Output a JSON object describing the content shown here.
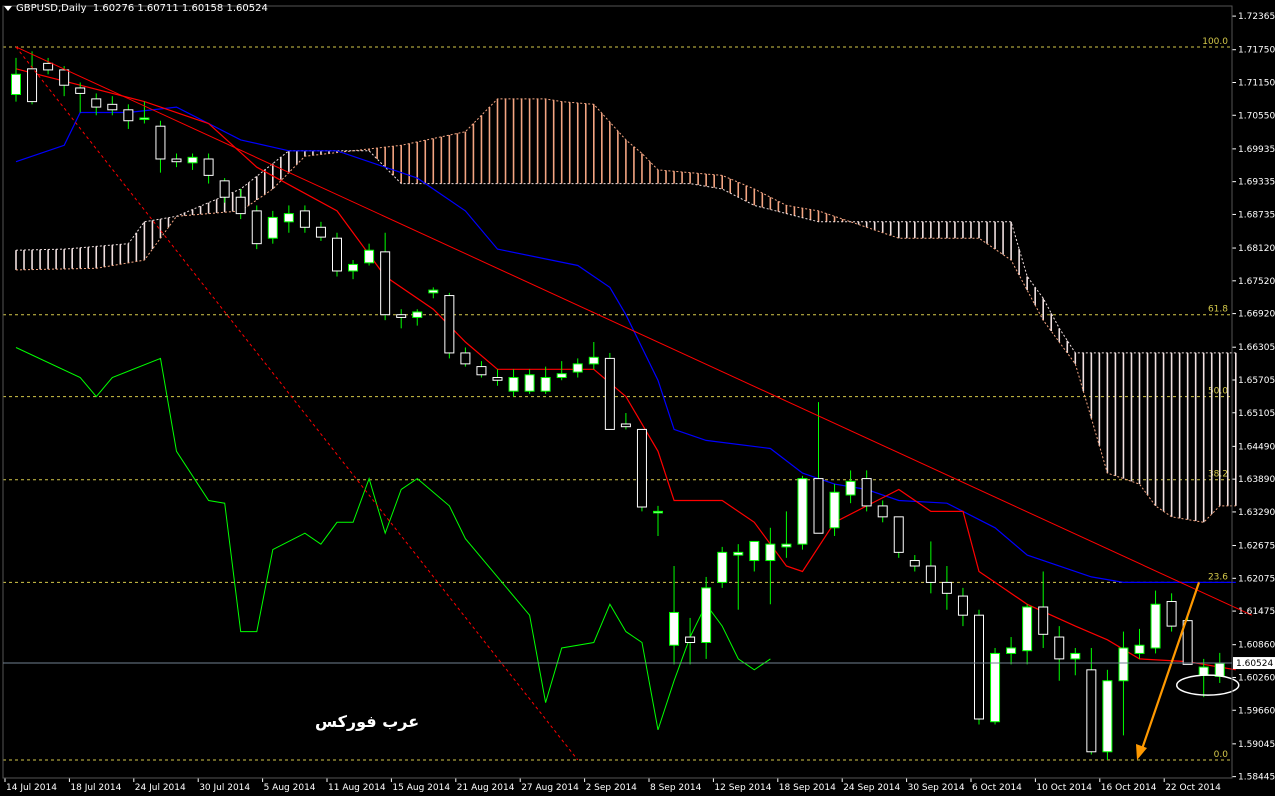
{
  "header": {
    "symbol": "GBPUSD,Daily",
    "ohlc": "1.60276 1.60711 1.60158 1.60524"
  },
  "watermark": "عرب فوركس",
  "current_price_label": "1.60524",
  "colors": {
    "background": "#000000",
    "bull_candle": "#ffffff",
    "bear_candle": "#000000",
    "wick": "#00ff00",
    "tenkan": "#ff0000",
    "kijun": "#0000ff",
    "chikou": "#00ff00",
    "cloud_bull": "#f4a582",
    "cloud_bear": "#f0e0e0",
    "trendline": "#ff0000",
    "fib": "#d4c84a",
    "arrow": "#ff9900",
    "current_price_line": "#708090"
  },
  "chart_data": {
    "type": "candlestick",
    "y_ticks": [
      "1.72365",
      "1.71750",
      "1.71150",
      "1.70550",
      "1.69935",
      "1.69335",
      "1.68735",
      "1.68120",
      "1.67520",
      "1.66920",
      "1.66305",
      "1.65705",
      "1.65105",
      "1.64490",
      "1.63890",
      "1.63290",
      "1.62675",
      "1.62075",
      "1.61475",
      "1.60860",
      "1.60260",
      "1.59660",
      "1.59045",
      "1.58445"
    ],
    "ylim": [
      1.5842,
      1.7255
    ],
    "x_ticks": [
      "14 Jul 2014",
      "18 Jul 2014",
      "24 Jul 2014",
      "30 Jul 2014",
      "5 Aug 2014",
      "11 Aug 2014",
      "15 Aug 2014",
      "21 Aug 2014",
      "27 Aug 2014",
      "2 Sep 2014",
      "8 Sep 2014",
      "12 Sep 2014",
      "18 Sep 2014",
      "24 Sep 2014",
      "30 Sep 2014",
      "6 Oct 2014",
      "10 Oct 2014",
      "16 Oct 2014",
      "22 Oct 2014"
    ],
    "fib_levels": [
      {
        "label": "100.0",
        "value": 1.718
      },
      {
        "label": "61.8",
        "value": 1.669
      },
      {
        "label": "50.0",
        "value": 1.654
      },
      {
        "label": "38.2",
        "value": 1.6388
      },
      {
        "label": "23.6",
        "value": 1.62
      },
      {
        "label": "0.0",
        "value": 1.5875
      }
    ],
    "current_price": 1.60524,
    "candles": [
      {
        "o": 1.7093,
        "h": 1.716,
        "l": 1.708,
        "c": 1.713
      },
      {
        "o": 1.714,
        "h": 1.7172,
        "l": 1.7075,
        "c": 1.708
      },
      {
        "o": 1.715,
        "h": 1.716,
        "l": 1.713,
        "c": 1.7138
      },
      {
        "o": 1.7138,
        "h": 1.7145,
        "l": 1.709,
        "c": 1.711
      },
      {
        "o": 1.7105,
        "h": 1.7115,
        "l": 1.706,
        "c": 1.7095
      },
      {
        "o": 1.7085,
        "h": 1.7095,
        "l": 1.7055,
        "c": 1.707
      },
      {
        "o": 1.7075,
        "h": 1.709,
        "l": 1.7055,
        "c": 1.7065
      },
      {
        "o": 1.7065,
        "h": 1.7075,
        "l": 1.703,
        "c": 1.7045
      },
      {
        "o": 1.705,
        "h": 1.708,
        "l": 1.704,
        "c": 1.705
      },
      {
        "o": 1.7035,
        "h": 1.7045,
        "l": 1.695,
        "c": 1.6975
      },
      {
        "o": 1.6975,
        "h": 1.6985,
        "l": 1.696,
        "c": 1.697
      },
      {
        "o": 1.6968,
        "h": 1.6985,
        "l": 1.6955,
        "c": 1.6978
      },
      {
        "o": 1.6975,
        "h": 1.6985,
        "l": 1.693,
        "c": 1.6945
      },
      {
        "o": 1.6935,
        "h": 1.694,
        "l": 1.6895,
        "c": 1.6905
      },
      {
        "o": 1.6905,
        "h": 1.692,
        "l": 1.6865,
        "c": 1.6875
      },
      {
        "o": 1.688,
        "h": 1.689,
        "l": 1.681,
        "c": 1.682
      },
      {
        "o": 1.683,
        "h": 1.688,
        "l": 1.682,
        "c": 1.6868
      },
      {
        "o": 1.686,
        "h": 1.689,
        "l": 1.684,
        "c": 1.6875
      },
      {
        "o": 1.688,
        "h": 1.689,
        "l": 1.684,
        "c": 1.685
      },
      {
        "o": 1.685,
        "h": 1.686,
        "l": 1.6825,
        "c": 1.6832
      },
      {
        "o": 1.683,
        "h": 1.684,
        "l": 1.676,
        "c": 1.677
      },
      {
        "o": 1.677,
        "h": 1.679,
        "l": 1.6755,
        "c": 1.6782
      },
      {
        "o": 1.6785,
        "h": 1.682,
        "l": 1.678,
        "c": 1.6808
      },
      {
        "o": 1.6805,
        "h": 1.684,
        "l": 1.668,
        "c": 1.669
      },
      {
        "o": 1.669,
        "h": 1.67,
        "l": 1.6665,
        "c": 1.6685
      },
      {
        "o": 1.6685,
        "h": 1.67,
        "l": 1.667,
        "c": 1.6695
      },
      {
        "o": 1.673,
        "h": 1.674,
        "l": 1.672,
        "c": 1.6735
      },
      {
        "o": 1.6725,
        "h": 1.673,
        "l": 1.661,
        "c": 1.662
      },
      {
        "o": 1.662,
        "h": 1.663,
        "l": 1.6595,
        "c": 1.66
      },
      {
        "o": 1.6595,
        "h": 1.6605,
        "l": 1.6575,
        "c": 1.658
      },
      {
        "o": 1.6575,
        "h": 1.659,
        "l": 1.656,
        "c": 1.657
      },
      {
        "o": 1.655,
        "h": 1.659,
        "l": 1.654,
        "c": 1.6575
      },
      {
        "o": 1.655,
        "h": 1.659,
        "l": 1.6545,
        "c": 1.658
      },
      {
        "o": 1.655,
        "h": 1.6595,
        "l": 1.6545,
        "c": 1.6575
      },
      {
        "o": 1.6575,
        "h": 1.6605,
        "l": 1.657,
        "c": 1.6582
      },
      {
        "o": 1.6585,
        "h": 1.661,
        "l": 1.6575,
        "c": 1.66
      },
      {
        "o": 1.66,
        "h": 1.664,
        "l": 1.659,
        "c": 1.6612
      },
      {
        "o": 1.661,
        "h": 1.662,
        "l": 1.648,
        "c": 1.648
      },
      {
        "o": 1.649,
        "h": 1.651,
        "l": 1.648,
        "c": 1.6485
      },
      {
        "o": 1.648,
        "h": 1.648,
        "l": 1.633,
        "c": 1.6338
      },
      {
        "o": 1.633,
        "h": 1.634,
        "l": 1.6285,
        "c": 1.633
      },
      {
        "o": 1.6085,
        "h": 1.623,
        "l": 1.605,
        "c": 1.6145
      },
      {
        "o": 1.61,
        "h": 1.6135,
        "l": 1.605,
        "c": 1.609
      },
      {
        "o": 1.609,
        "h": 1.621,
        "l": 1.606,
        "c": 1.619
      },
      {
        "o": 1.62,
        "h": 1.6265,
        "l": 1.619,
        "c": 1.6255
      },
      {
        "o": 1.625,
        "h": 1.627,
        "l": 1.615,
        "c": 1.6255
      },
      {
        "o": 1.624,
        "h": 1.6275,
        "l": 1.622,
        "c": 1.6275
      },
      {
        "o": 1.624,
        "h": 1.63,
        "l": 1.616,
        "c": 1.627
      },
      {
        "o": 1.6265,
        "h": 1.633,
        "l": 1.6245,
        "c": 1.627
      },
      {
        "o": 1.627,
        "h": 1.6395,
        "l": 1.626,
        "c": 1.639
      },
      {
        "o": 1.639,
        "h": 1.653,
        "l": 1.629,
        "c": 1.629
      },
      {
        "o": 1.63,
        "h": 1.638,
        "l": 1.6285,
        "c": 1.6365
      },
      {
        "o": 1.636,
        "h": 1.6405,
        "l": 1.6345,
        "c": 1.6385
      },
      {
        "o": 1.639,
        "h": 1.6405,
        "l": 1.633,
        "c": 1.634
      },
      {
        "o": 1.634,
        "h": 1.635,
        "l": 1.631,
        "c": 1.632
      },
      {
        "o": 1.632,
        "h": 1.632,
        "l": 1.6245,
        "c": 1.6255
      },
      {
        "o": 1.624,
        "h": 1.625,
        "l": 1.622,
        "c": 1.623
      },
      {
        "o": 1.623,
        "h": 1.6275,
        "l": 1.618,
        "c": 1.62
      },
      {
        "o": 1.62,
        "h": 1.623,
        "l": 1.615,
        "c": 1.618
      },
      {
        "o": 1.6175,
        "h": 1.619,
        "l": 1.612,
        "c": 1.614
      },
      {
        "o": 1.614,
        "h": 1.615,
        "l": 1.594,
        "c": 1.595
      },
      {
        "o": 1.5945,
        "h": 1.608,
        "l": 1.594,
        "c": 1.607
      },
      {
        "o": 1.607,
        "h": 1.61,
        "l": 1.605,
        "c": 1.608
      },
      {
        "o": 1.6075,
        "h": 1.616,
        "l": 1.605,
        "c": 1.6155
      },
      {
        "o": 1.6155,
        "h": 1.622,
        "l": 1.608,
        "c": 1.6105
      },
      {
        "o": 1.61,
        "h": 1.612,
        "l": 1.602,
        "c": 1.606
      },
      {
        "o": 1.606,
        "h": 1.608,
        "l": 1.603,
        "c": 1.607
      },
      {
        "o": 1.604,
        "h": 1.608,
        "l": 1.5885,
        "c": 1.589
      },
      {
        "o": 1.589,
        "h": 1.604,
        "l": 1.5875,
        "c": 1.602
      },
      {
        "o": 1.602,
        "h": 1.611,
        "l": 1.592,
        "c": 1.608
      },
      {
        "o": 1.607,
        "h": 1.6115,
        "l": 1.606,
        "c": 1.6085
      },
      {
        "o": 1.608,
        "h": 1.6185,
        "l": 1.607,
        "c": 1.616
      },
      {
        "o": 1.6165,
        "h": 1.618,
        "l": 1.611,
        "c": 1.612
      },
      {
        "o": 1.613,
        "h": 1.614,
        "l": 1.605,
        "c": 1.605
      },
      {
        "o": 1.603,
        "h": 1.606,
        "l": 1.599,
        "c": 1.6045
      },
      {
        "o": 1.6028,
        "h": 1.6071,
        "l": 1.6016,
        "c": 1.6052
      }
    ],
    "tenkan": [
      [
        0,
        1.714
      ],
      [
        8,
        1.708
      ],
      [
        12,
        1.704
      ],
      [
        15,
        1.696
      ],
      [
        20,
        1.688
      ],
      [
        23,
        1.676
      ],
      [
        26,
        1.67
      ],
      [
        28,
        1.664
      ],
      [
        30,
        1.659
      ],
      [
        36,
        1.659
      ],
      [
        38,
        1.654
      ],
      [
        40,
        1.644
      ],
      [
        41,
        1.635
      ],
      [
        44,
        1.635
      ],
      [
        46,
        1.631
      ],
      [
        48,
        1.623
      ],
      [
        49,
        1.622
      ],
      [
        51,
        1.631
      ],
      [
        53,
        1.634
      ],
      [
        55,
        1.637
      ],
      [
        57,
        1.633
      ],
      [
        59,
        1.633
      ],
      [
        60,
        1.622
      ],
      [
        61,
        1.62
      ],
      [
        63,
        1.616
      ],
      [
        66,
        1.612
      ],
      [
        68,
        1.6095
      ],
      [
        70,
        1.606
      ],
      [
        73,
        1.6055
      ],
      [
        76,
        1.604
      ]
    ],
    "kijun": [
      [
        0,
        1.697
      ],
      [
        3,
        1.7
      ],
      [
        4,
        1.706
      ],
      [
        7,
        1.706
      ],
      [
        10,
        1.707
      ],
      [
        14,
        1.701
      ],
      [
        17,
        1.699
      ],
      [
        20,
        1.699
      ],
      [
        25,
        1.694
      ],
      [
        28,
        1.688
      ],
      [
        30,
        1.681
      ],
      [
        35,
        1.678
      ],
      [
        37,
        1.674
      ],
      [
        38,
        1.669
      ],
      [
        40,
        1.657
      ],
      [
        41,
        1.648
      ],
      [
        43,
        1.646
      ],
      [
        47,
        1.6445
      ],
      [
        49,
        1.64
      ],
      [
        51,
        1.638
      ],
      [
        53,
        1.637
      ],
      [
        55,
        1.635
      ],
      [
        58,
        1.6345
      ],
      [
        61,
        1.63
      ],
      [
        63,
        1.625
      ],
      [
        67,
        1.621
      ],
      [
        69,
        1.62
      ],
      [
        76,
        1.62
      ]
    ],
    "chikou": [
      [
        0,
        1.663
      ],
      [
        4,
        1.6575
      ],
      [
        5,
        1.654
      ],
      [
        6,
        1.6575
      ],
      [
        9,
        1.661
      ],
      [
        10,
        1.644
      ],
      [
        12,
        1.635
      ],
      [
        13,
        1.6345
      ],
      [
        14,
        1.611
      ],
      [
        15,
        1.611
      ],
      [
        16,
        1.626
      ],
      [
        18,
        1.629
      ],
      [
        19,
        1.627
      ],
      [
        20,
        1.631
      ],
      [
        21,
        1.631
      ],
      [
        22,
        1.639
      ],
      [
        23,
        1.629
      ],
      [
        24,
        1.637
      ],
      [
        25,
        1.639
      ],
      [
        27,
        1.634
      ],
      [
        28,
        1.628
      ],
      [
        30,
        1.621
      ],
      [
        32,
        1.614
      ],
      [
        33,
        1.598
      ],
      [
        34,
        1.608
      ],
      [
        36,
        1.609
      ],
      [
        37,
        1.616
      ],
      [
        38,
        1.611
      ],
      [
        39,
        1.609
      ],
      [
        40,
        1.593
      ],
      [
        41,
        1.602
      ],
      [
        42,
        1.61
      ],
      [
        43,
        1.616
      ],
      [
        44,
        1.612
      ],
      [
        45,
        1.606
      ],
      [
        46,
        1.604
      ],
      [
        47,
        1.606
      ]
    ],
    "cloud": {
      "start_index": 0,
      "span_a": [
        [
          0,
          1.6772
        ],
        [
          5,
          1.6775
        ],
        [
          8,
          1.679
        ],
        [
          9,
          1.683
        ],
        [
          10,
          1.687
        ],
        [
          14,
          1.688
        ],
        [
          16,
          1.692
        ],
        [
          18,
          1.698
        ],
        [
          24,
          1.7
        ],
        [
          28,
          1.7025
        ],
        [
          30,
          1.7085
        ],
        [
          33,
          1.7085
        ],
        [
          34,
          1.708
        ],
        [
          36,
          1.7075
        ],
        [
          38,
          1.701
        ],
        [
          39,
          1.6985
        ],
        [
          40,
          1.6955
        ],
        [
          44,
          1.6945
        ],
        [
          46,
          1.692
        ],
        [
          48,
          1.689
        ],
        [
          50,
          1.688
        ],
        [
          52,
          1.686
        ],
        [
          55,
          1.683
        ],
        [
          60,
          1.683
        ],
        [
          62,
          1.679
        ],
        [
          64,
          1.668
        ],
        [
          66,
          1.66
        ],
        [
          67,
          1.65
        ],
        [
          68,
          1.64
        ],
        [
          70,
          1.638
        ],
        [
          71,
          1.634
        ],
        [
          72,
          1.632
        ],
        [
          74,
          1.631
        ],
        [
          75,
          1.634
        ],
        [
          76,
          1.634
        ]
      ],
      "span_b": [
        [
          0,
          1.6808
        ],
        [
          3,
          1.681
        ],
        [
          7,
          1.682
        ],
        [
          8,
          1.686
        ],
        [
          10,
          1.687
        ],
        [
          14,
          1.692
        ],
        [
          17,
          1.699
        ],
        [
          22,
          1.699
        ],
        [
          24,
          1.693
        ],
        [
          30,
          1.693
        ],
        [
          36,
          1.693
        ],
        [
          42,
          1.693
        ],
        [
          44,
          1.692
        ],
        [
          46,
          1.689
        ],
        [
          50,
          1.686
        ],
        [
          60,
          1.686
        ],
        [
          62,
          1.686
        ],
        [
          63,
          1.676
        ],
        [
          64,
          1.672
        ],
        [
          65,
          1.6665
        ],
        [
          66,
          1.662
        ],
        [
          76,
          1.662
        ]
      ]
    },
    "trendlines": [
      {
        "from": [
          0,
          1.718
        ],
        "to": [
          77,
          1.614
        ],
        "style": "solid"
      },
      {
        "from": [
          0,
          1.718
        ],
        "to": [
          35,
          1.5875
        ],
        "style": "dashed"
      }
    ]
  }
}
